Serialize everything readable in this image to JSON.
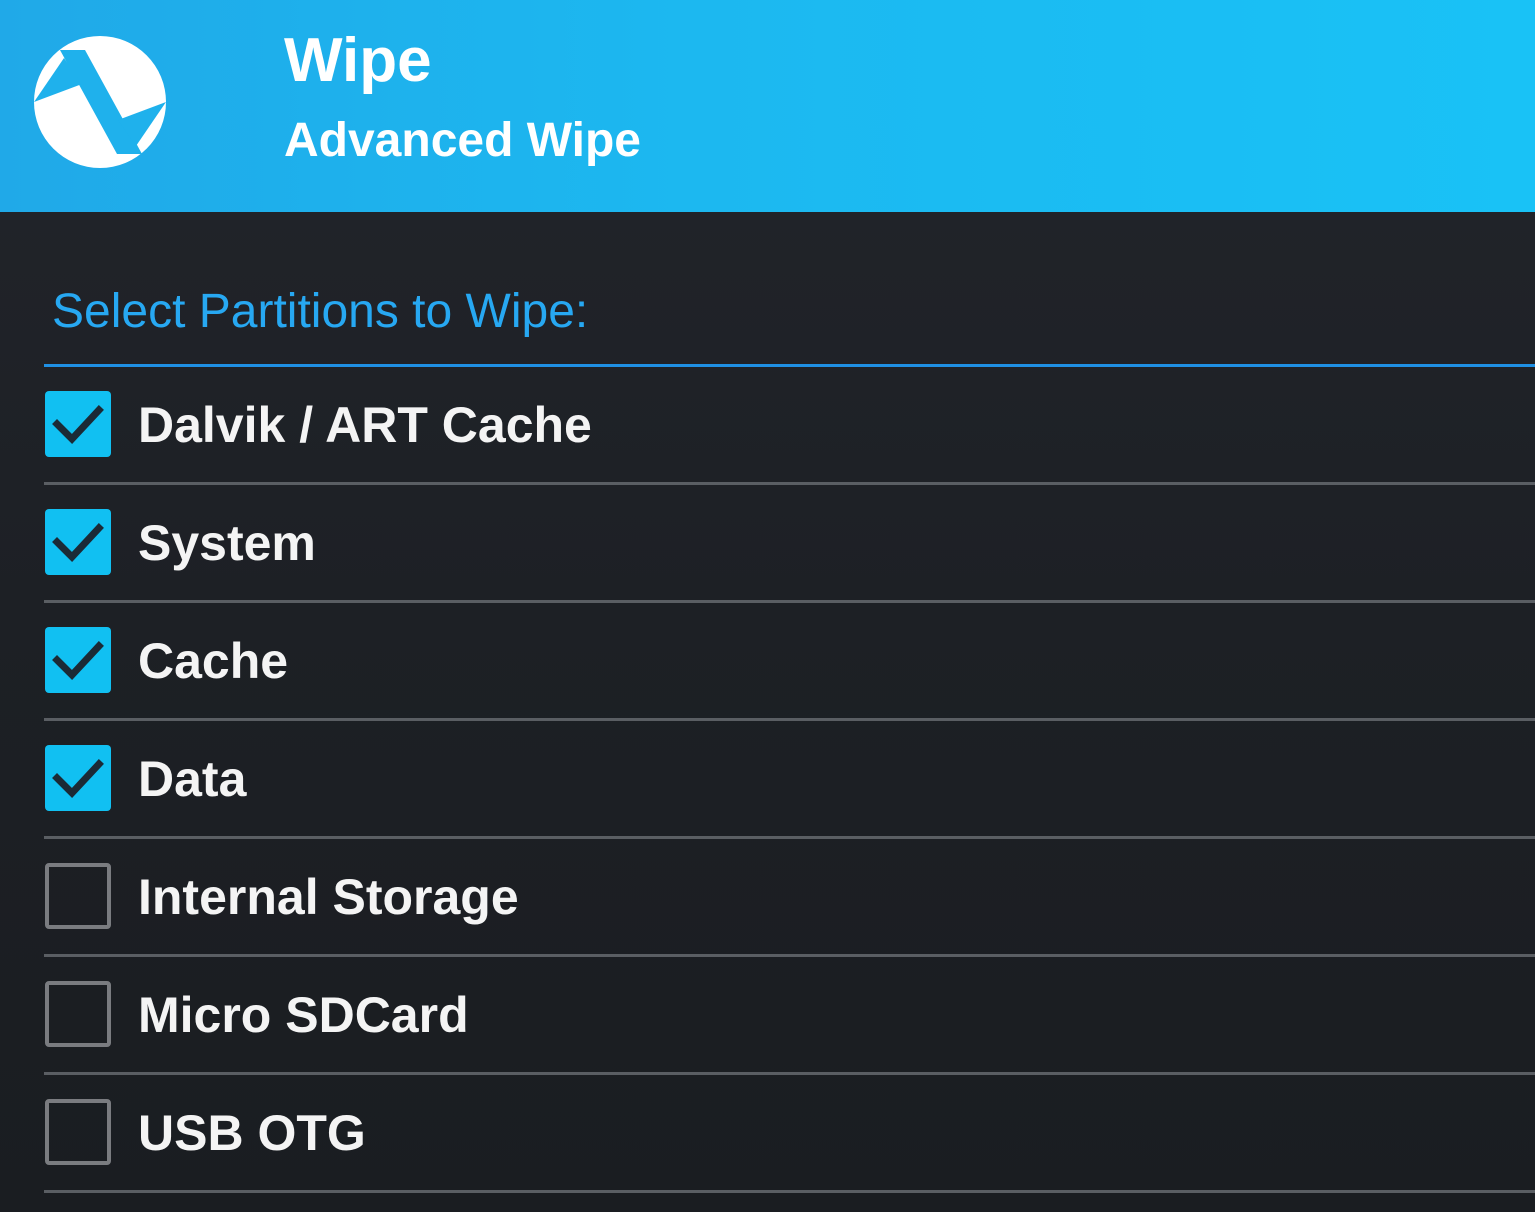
{
  "header": {
    "title": "Wipe",
    "subtitle": "Advanced Wipe",
    "logo_icon": "twrp-logo-icon"
  },
  "section": {
    "heading": "Select Partitions to Wipe:"
  },
  "colors": {
    "header_blue": "#1cb8f0",
    "accent": "#11c0f2",
    "heading_blue": "#27a8f2",
    "background": "#1d2025"
  },
  "partitions": [
    {
      "label": "Dalvik / ART Cache",
      "checked": true
    },
    {
      "label": "System",
      "checked": true
    },
    {
      "label": "Cache",
      "checked": true
    },
    {
      "label": "Data",
      "checked": true
    },
    {
      "label": "Internal Storage",
      "checked": false
    },
    {
      "label": "Micro SDCard",
      "checked": false
    },
    {
      "label": "USB OTG",
      "checked": false
    }
  ]
}
